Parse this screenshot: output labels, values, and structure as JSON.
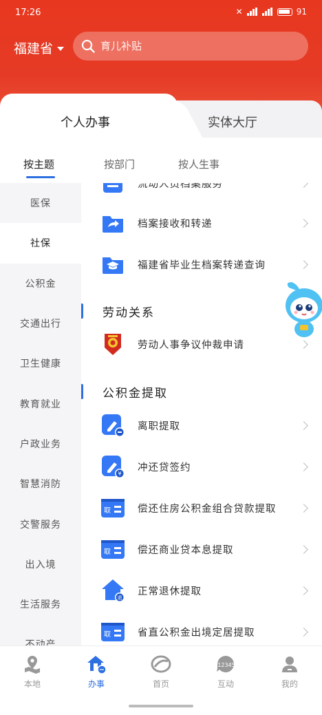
{
  "status": {
    "time": "17:26",
    "battery": "91"
  },
  "header": {
    "region": "福建省",
    "search_placeholder": "育儿补贴"
  },
  "top_tabs": [
    {
      "label": "个人办事",
      "active": true
    },
    {
      "label": "实体大厅",
      "active": false
    }
  ],
  "sub_tabs": [
    {
      "label": "按主题",
      "active": true
    },
    {
      "label": "按部门"
    },
    {
      "label": "按人生事"
    }
  ],
  "sidebar": [
    {
      "label": "医保"
    },
    {
      "label": "社保",
      "active": true
    },
    {
      "label": "公积金"
    },
    {
      "label": "交通出行"
    },
    {
      "label": "卫生健康"
    },
    {
      "label": "教育就业"
    },
    {
      "label": "户政业务"
    },
    {
      "label": "智慧消防"
    },
    {
      "label": "交警服务"
    },
    {
      "label": "出入境"
    },
    {
      "label": "生活服务"
    },
    {
      "label": "不动产"
    }
  ],
  "content": {
    "partial_item": {
      "label": "流动人员档案服务",
      "icon": "document-list-icon"
    },
    "items_a": [
      {
        "label": "档案接收和转递",
        "icon": "folder-share-icon"
      },
      {
        "label": "福建省毕业生档案转递查询",
        "icon": "graduation-folder-icon"
      }
    ],
    "section_labor": {
      "title": "劳动关系"
    },
    "items_labor": [
      {
        "label": "劳动人事争议仲裁申请",
        "icon": "arbitration-emblem-icon"
      }
    ],
    "section_fund": {
      "title": "公积金提取"
    },
    "items_fund": [
      {
        "label": "离职提取",
        "icon": "edit-minus-icon"
      },
      {
        "label": "冲还贷签约",
        "icon": "edit-yuan-icon"
      },
      {
        "label": "偿还住房公积金组合贷款提取",
        "icon": "withdraw-card-icon",
        "badge": "取"
      },
      {
        "label": "偿还商业贷本息提取",
        "icon": "withdraw-card-icon",
        "badge": "取"
      },
      {
        "label": "正常退休提取",
        "icon": "house-retire-icon",
        "badge": "退"
      },
      {
        "label": "省直公积金出境定居提取",
        "icon": "withdraw-card-icon",
        "badge": "取"
      }
    ]
  },
  "bottom_nav": [
    {
      "label": "本地",
      "icon": "location-map-icon"
    },
    {
      "label": "办事",
      "icon": "services-house-icon",
      "active": true
    },
    {
      "label": "首页",
      "icon": "home-logo-icon"
    },
    {
      "label": "互动",
      "icon": "hotline-12345-icon",
      "badge": "12345"
    },
    {
      "label": "我的",
      "icon": "profile-icon"
    }
  ],
  "colors": {
    "header_red": "#e53b26",
    "accent_blue": "#2c6fe0",
    "icon_blue": "#3478f6"
  }
}
